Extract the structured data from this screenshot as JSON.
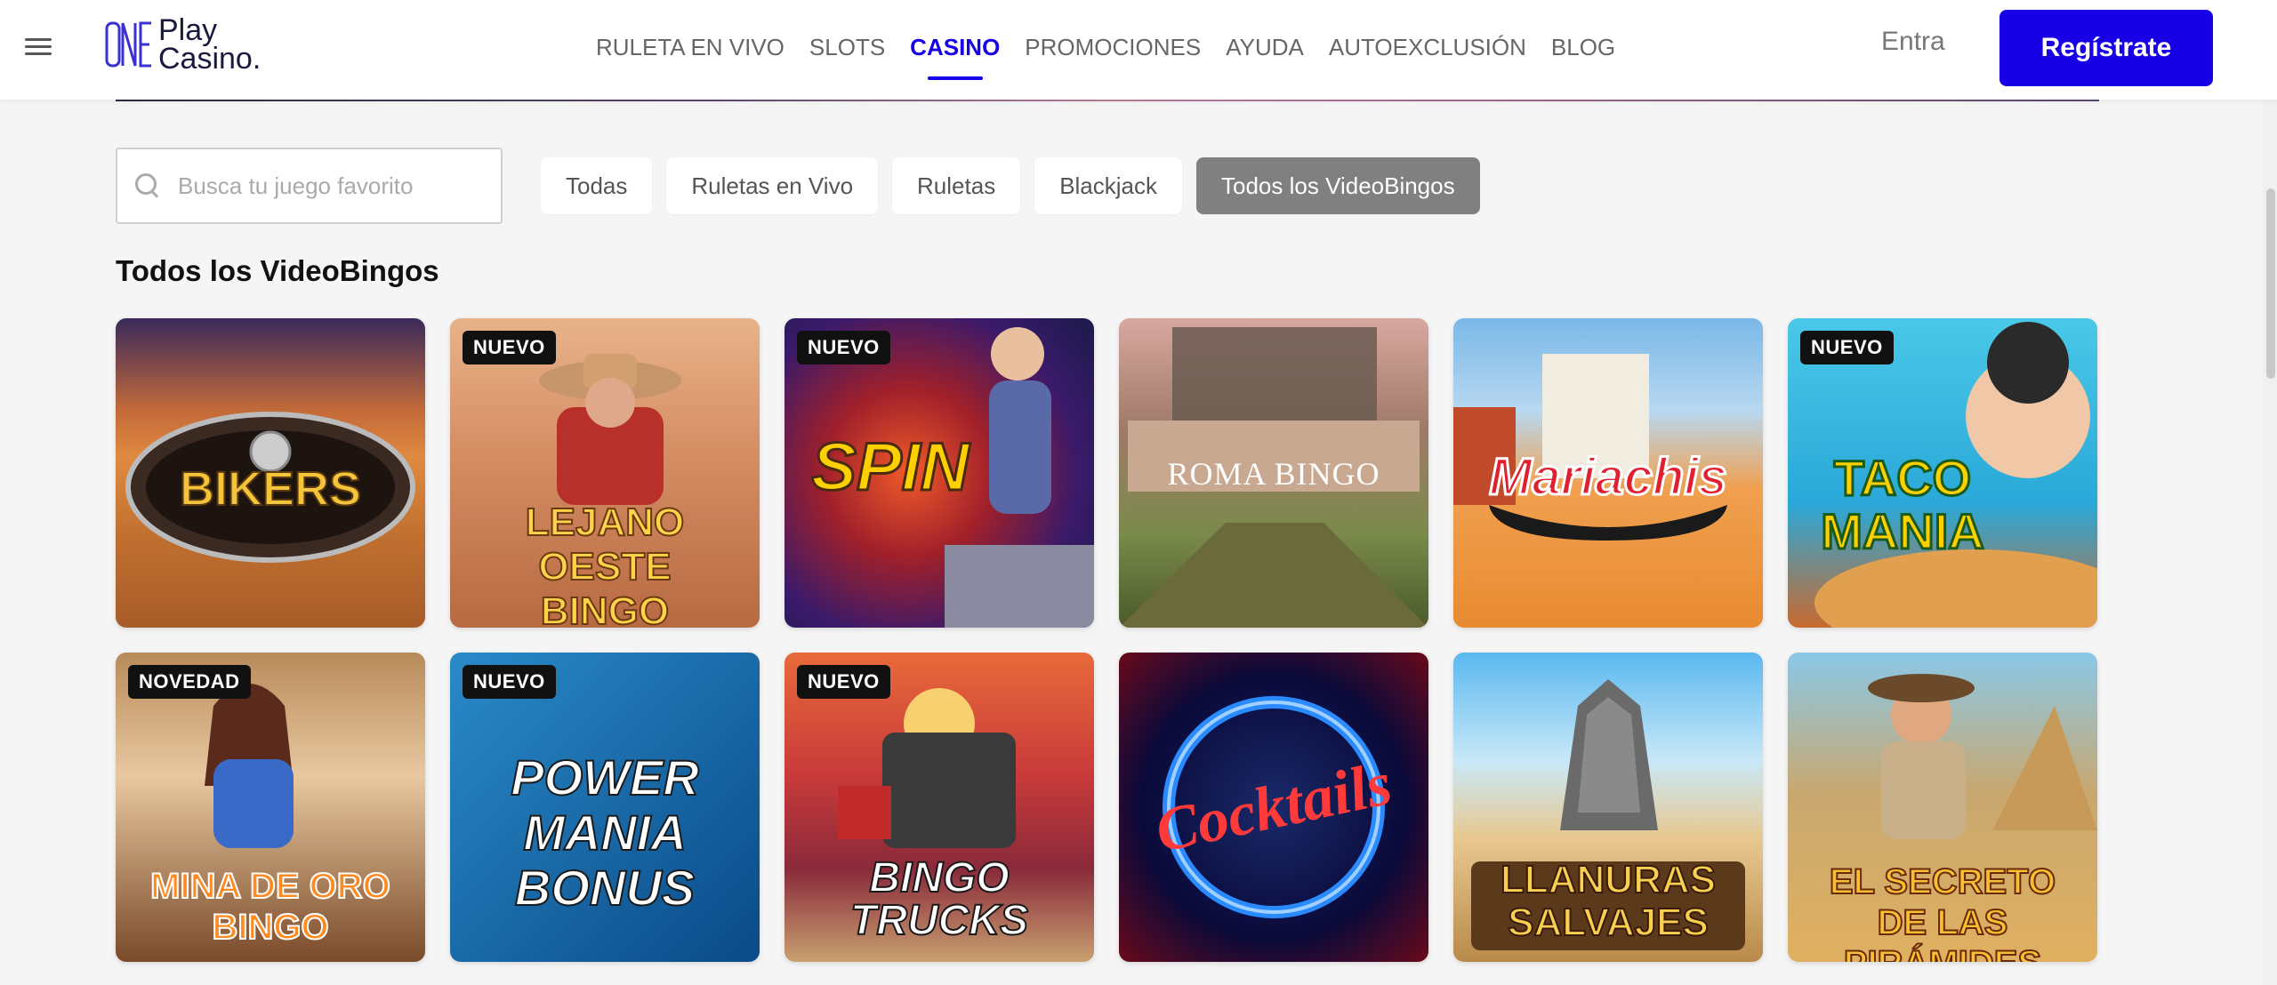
{
  "header": {
    "logo_text": "Play\nCasino.",
    "logo_mark": "ONE",
    "nav": [
      {
        "label": "RULETA EN VIVO",
        "active": false
      },
      {
        "label": "SLOTS",
        "active": false
      },
      {
        "label": "CASINO",
        "active": true
      },
      {
        "label": "PROMOCIONES",
        "active": false
      },
      {
        "label": "AYUDA",
        "active": false
      },
      {
        "label": "AUTOEXCLUSIÓN",
        "active": false
      },
      {
        "label": "BLOG",
        "active": false
      }
    ],
    "login_label": "Entra",
    "register_label": "Regístrate"
  },
  "search": {
    "placeholder": "Busca tu juego favorito"
  },
  "filters": [
    {
      "label": "Todas",
      "active": false
    },
    {
      "label": "Ruletas en Vivo",
      "active": false
    },
    {
      "label": "Ruletas",
      "active": false
    },
    {
      "label": "Blackjack",
      "active": false
    },
    {
      "label": "Todos los VideoBingos",
      "active": true
    }
  ],
  "section_title": "Todos los VideoBingos",
  "games": [
    {
      "title": "BIKERS",
      "badge": ""
    },
    {
      "title": "LEJANO OESTE BINGO",
      "badge": "NUEVO"
    },
    {
      "title": "SPIN",
      "badge": "NUEVO"
    },
    {
      "title": "ROMA BINGO",
      "badge": ""
    },
    {
      "title": "Mariachis",
      "badge": ""
    },
    {
      "title": "TACO MANIA",
      "badge": "NUEVO"
    },
    {
      "title": "MINA DE ORO BINGO",
      "badge": "NOVEDAD"
    },
    {
      "title": "POWER MANIA BONUS",
      "badge": "NUEVO"
    },
    {
      "title": "BINGO TRUCKS",
      "badge": "NUEVO"
    },
    {
      "title": "Cocktails",
      "badge": ""
    },
    {
      "title": "LLANURAS SALVAJES",
      "badge": ""
    },
    {
      "title": "EL SECRETO DE LAS PIRÁMIDES",
      "badge": ""
    }
  ],
  "colors": {
    "brand": "#1700e6",
    "active_chip": "#808080",
    "badge_bg": "#111111"
  }
}
